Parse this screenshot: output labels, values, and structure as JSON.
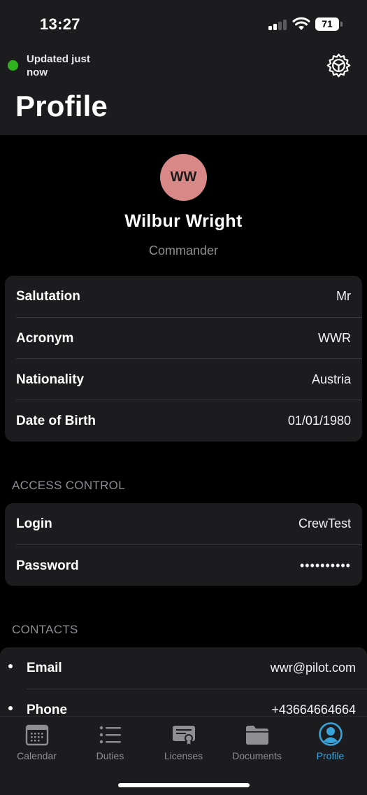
{
  "status_bar": {
    "time": "13:27",
    "battery": "71"
  },
  "header": {
    "updated_text": "Updated just now",
    "title": "Profile"
  },
  "profile": {
    "initials": "WW",
    "name": "Wilbur Wright",
    "role": "Commander",
    "avatar_color": "#d98888"
  },
  "details": [
    {
      "label": "Salutation",
      "value": "Mr"
    },
    {
      "label": "Acronym",
      "value": "WWR"
    },
    {
      "label": "Nationality",
      "value": "Austria"
    },
    {
      "label": "Date of Birth",
      "value": "01/01/1980"
    }
  ],
  "access_control": {
    "header": "ACCESS CONTROL",
    "rows": [
      {
        "label": "Login",
        "value": "CrewTest"
      },
      {
        "label": "Password",
        "value": "••••••••••"
      }
    ]
  },
  "contacts": {
    "header": "CONTACTS",
    "rows": [
      {
        "label": "Email",
        "value": "wwr@pilot.com"
      },
      {
        "label": "Phone",
        "value": "+43664664664"
      }
    ]
  },
  "tabs": [
    {
      "label": "Calendar",
      "icon": "calendar-icon"
    },
    {
      "label": "Duties",
      "icon": "list-icon"
    },
    {
      "label": "Licenses",
      "icon": "certificate-icon"
    },
    {
      "label": "Documents",
      "icon": "folder-icon"
    },
    {
      "label": "Profile",
      "icon": "person-circle-icon",
      "active": true
    }
  ],
  "colors": {
    "accent": "#38a3d9",
    "online": "#30b21e",
    "card": "#1c1c1e"
  }
}
